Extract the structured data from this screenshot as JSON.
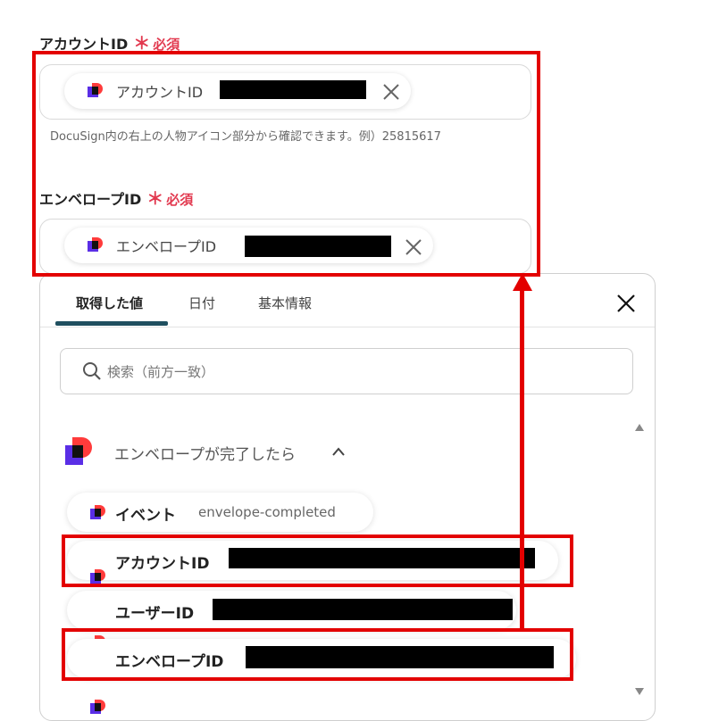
{
  "form": {
    "account_field": {
      "label": "アカウントID",
      "required_mark": "＊",
      "required_text": "必須",
      "chip_label": "アカウントID",
      "hint": "DocuSign内の右上の人物アイコン部分から確認できます。例）25815617"
    },
    "envelope_field": {
      "label": "エンベロープID",
      "required_mark": "＊",
      "required_text": "必須",
      "chip_label": "エンベロープID"
    }
  },
  "picker": {
    "tabs": [
      "取得した値",
      "日付",
      "基本情報"
    ],
    "active_tab": 0,
    "search_placeholder": "検索（前方一致）",
    "group": {
      "title": "エンベロープが完了したら",
      "expanded": true
    },
    "items": [
      {
        "name": "イベント",
        "value": "envelope-completed"
      },
      {
        "name": "アカウントID",
        "value": ""
      },
      {
        "name": "ユーザーID",
        "value": ""
      },
      {
        "name": "エンベロープID",
        "value": ""
      }
    ]
  },
  "colors": {
    "highlight": "#e30000",
    "required": "#e2394f",
    "tab_indicator": "#1f4f5f",
    "logo_blue": "#5a2ee6",
    "logo_red": "#ff3b3b"
  },
  "icons": [
    "docusign-logo-icon",
    "close-icon",
    "search-icon",
    "chevron-up-icon",
    "scroll-up-icon",
    "scroll-down-icon",
    "arrow-up-icon"
  ]
}
